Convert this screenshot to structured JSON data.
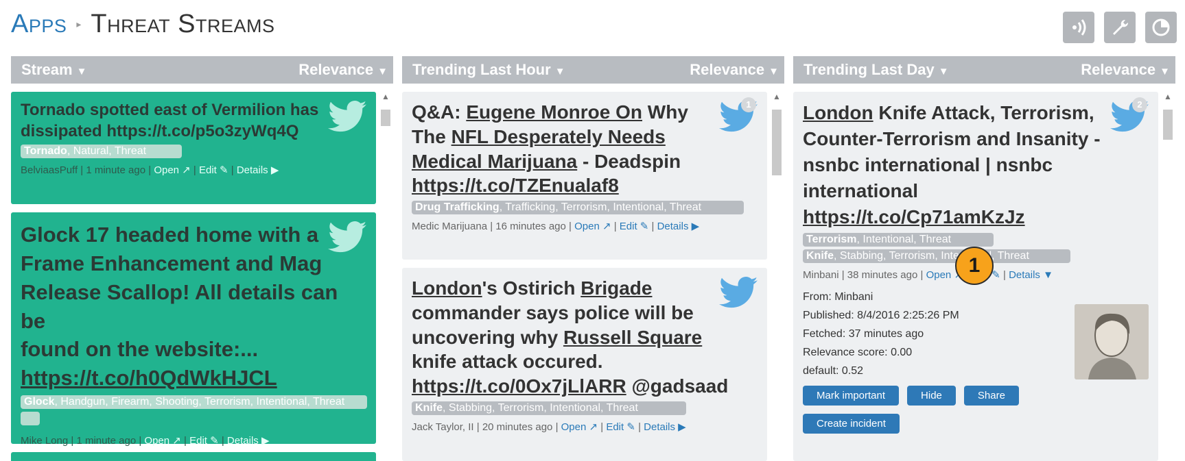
{
  "breadcrumb": {
    "apps": "Apps",
    "separator": "▸",
    "title": "Threat Streams"
  },
  "toolbar": {
    "icons": [
      "broadcast-icon",
      "wrench-icon",
      "pie-chart-icon"
    ]
  },
  "columns": [
    {
      "title": "Stream",
      "sort": "Relevance",
      "cards": [
        {
          "text": "Tornado spotted east of Vermilion has dissipated https://t.co/p5o3zyWq4Q",
          "tag_main": "Tornado",
          "tag_rest": ", Natural, Threat",
          "author": "BelviaasPuff",
          "time": "1 minute ago",
          "open": "Open ↗",
          "edit": "Edit ✎",
          "details": "Details ▶"
        },
        {
          "text_lines": [
            "Glock 17 headed home with a",
            "Frame Enhancement and Mag",
            "Release Scallop! All details can be",
            "found on the website:..."
          ],
          "link": "https://t.co/h0QdWkHJCL",
          "tag_main": "Glock",
          "tag_rest": ", Handgun, Firearm, Shooting, Terrorism, Intentional, Threat",
          "author": "Mike Long",
          "time": "1 minute ago",
          "open": "Open ↗",
          "edit": "Edit ✎",
          "details": "Details ▶"
        }
      ]
    },
    {
      "title": "Trending Last Hour",
      "sort": "Relevance",
      "cards": [
        {
          "badge": "1",
          "p1": "Q&A: ",
          "u1": "Eugene Monroe On",
          "p2": " Why The ",
          "u2": "NFL Desperately Needs Medical Marijuana",
          "p3": " - Deadspin ",
          "link": "https://t.co/TZEnualaf8",
          "tag_main": "Drug Trafficking",
          "tag_rest": ", Trafficking, Terrorism, Intentional, Threat",
          "author": "Medic Marijuana",
          "time": "16 minutes ago",
          "open": "Open ↗",
          "edit": "Edit ✎",
          "details": "Details ▶"
        },
        {
          "u1": "London",
          "p1": "'s Ostirich ",
          "u2": "Brigade",
          "p2": " commander says police will be uncovering why ",
          "u3": "Russell Square",
          "p3": " knife attack occured. ",
          "link": "https://t.co/0Ox7jLlARR",
          "p4": " @gadsaad",
          "tag_main": "Knife",
          "tag_rest": ", Stabbing, Terrorism, Intentional, Threat",
          "author": "Jack Taylor, II",
          "time": "20 minutes ago",
          "open": "Open ↗",
          "edit": "Edit ✎",
          "details": "Details ▶"
        }
      ]
    },
    {
      "title": "Trending Last Day",
      "sort": "Relevance",
      "cards": [
        {
          "badge": "2",
          "u1": "London",
          "p1": " Knife Attack, Terrorism, Counter-Terrorism and Insanity - nsnbc international | nsnbc international ",
          "link": "https://t.co/Cp71amKzJz",
          "tag1_main": "Terrorism",
          "tag1_rest": ", Intentional, Threat",
          "tag2_main": "Knife",
          "tag2_rest": ", Stabbing, Terrorism, Intentional, Threat",
          "author": "Minbani",
          "time": "38 minutes ago",
          "open": "Open ↗",
          "edit": "Edit ✎",
          "details": "Details ▼",
          "from": "From: Minbani",
          "published": "Published: 8/4/2016 2:25:26 PM",
          "fetched": "Fetched: 37 minutes ago",
          "relevance": "Relevance score: 0.00",
          "default": "default: 0.52",
          "buttons": {
            "mark": "Mark important",
            "hide": "Hide",
            "share": "Share",
            "incident": "Create incident"
          }
        }
      ]
    }
  ],
  "callout": "1",
  "colors": {
    "green": "#21b38f",
    "blue": "#2e79b7",
    "header_grey": "#b8bcc1",
    "callout": "#f7a21b"
  }
}
